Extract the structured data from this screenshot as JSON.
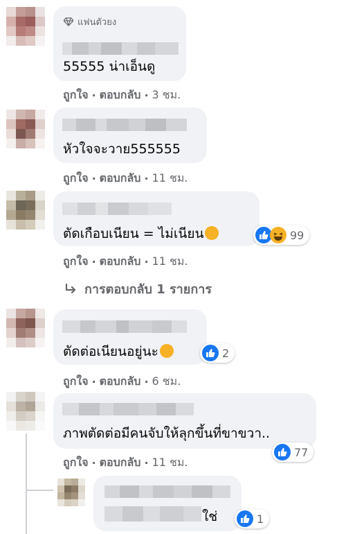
{
  "badge": {
    "label": "แฟนตัวยง",
    "icon": "diamond-icon"
  },
  "actions": {
    "like": "ถูกใจ",
    "reply": "ตอบกลับ",
    "separator": "·"
  },
  "comments": [
    {
      "text": "55555 น่าเอ็นดู",
      "time": "3 ชม."
    },
    {
      "text": "หัวใจจะวาย555555",
      "time": "11 ชม."
    },
    {
      "text": "ตัดเกือบเนียน = ไม่เนียน",
      "time": "11 ชม.",
      "reaction_count": "99",
      "reaction_icons": [
        "like-icon",
        "haha-icon"
      ]
    },
    {
      "text": "ตัดต่อเนียนอยู่นะ",
      "time": "6 ชม.",
      "reaction_count": "2",
      "reaction_icons": [
        "like-icon"
      ]
    },
    {
      "text": "ภาพตัดต่อมีคนจับให้ลุกขึ้นที่ขาขวา..",
      "time": "11 ชม.",
      "reaction_count": "77",
      "reaction_icons": [
        "like-icon"
      ]
    }
  ],
  "replies_link": {
    "label": "การตอบกลับ 1 รายการ",
    "icon": "reply-arrow-icon"
  },
  "reply": {
    "text": "ใช่",
    "reaction_count": "1",
    "reaction_icons": [
      "like-icon"
    ]
  },
  "colors": {
    "bubble": "#f0f2f5",
    "like": "#1877f2",
    "haha": "#f7b125",
    "meta": "#65676b"
  }
}
